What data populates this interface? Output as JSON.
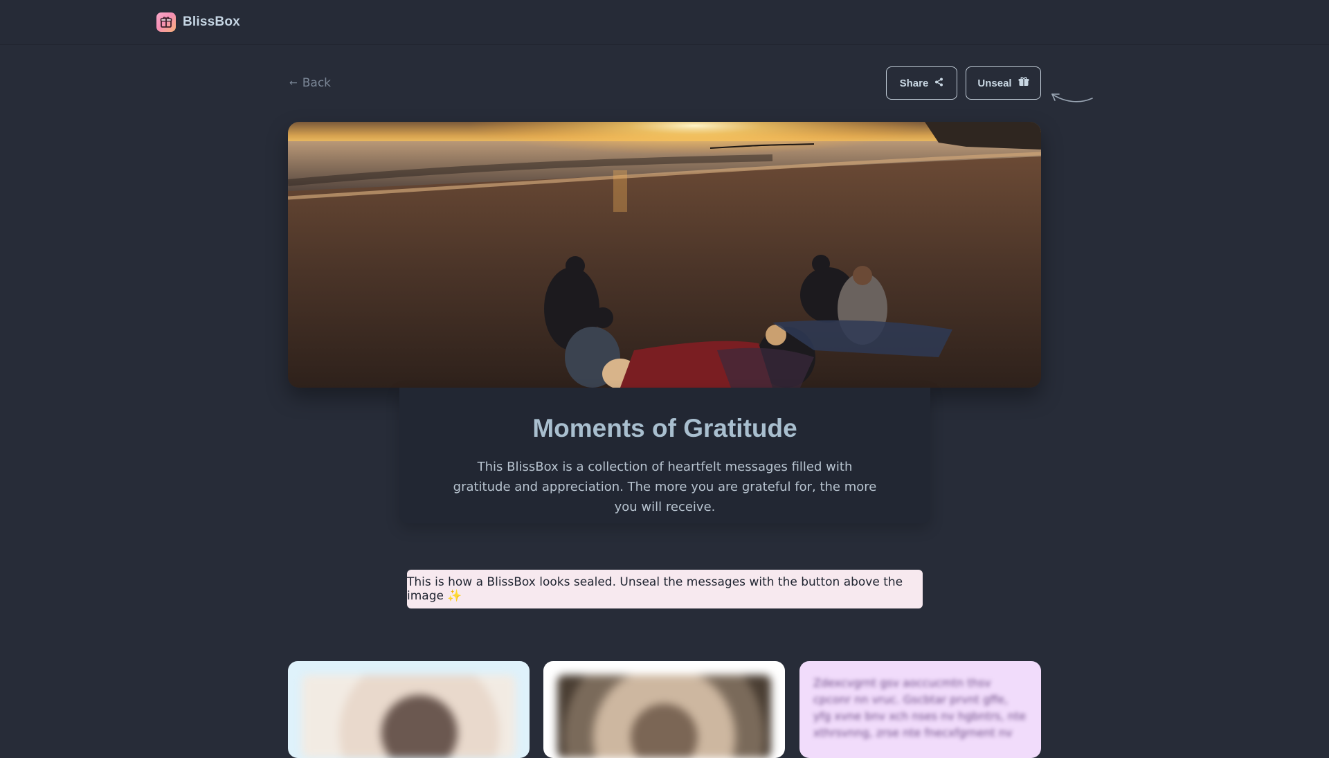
{
  "header": {
    "brand": "BlissBox",
    "logo_icon": "gift-icon"
  },
  "nav": {
    "back_label": "Back"
  },
  "actions": {
    "share_label": "Share",
    "unseal_label": "Unseal"
  },
  "hero": {
    "image_alt": "Group of friends sitting on blankets on a sandy beach at sunset"
  },
  "box": {
    "title": "Moments of Gratitude",
    "description": "This BlissBox is a collection of heartfelt messages filled with gratitude and appreciation. The more you are grateful for, the more you will receive."
  },
  "notice": {
    "text": "This is how a BlissBox looks sealed. Unseal the messages with the button above the image ✨"
  },
  "cards": [
    {
      "type": "photo"
    },
    {
      "type": "photo"
    },
    {
      "type": "text",
      "text": "Zdexcvgrnt gsv aoccucmtn thsv cpconr nn vruc. Gscbtar prvnt gffe, yfg xvne bnv xch nses nv hgbntrs, nte xthrsvnng, zrse nte fnecxfgrnent nv"
    }
  ],
  "colors": {
    "background": "#272c38",
    "notice_bg": "#f7e9ef",
    "card_blue": "#dff2fb",
    "card_white": "#ffffff",
    "card_purple": "#f1dcfb"
  }
}
